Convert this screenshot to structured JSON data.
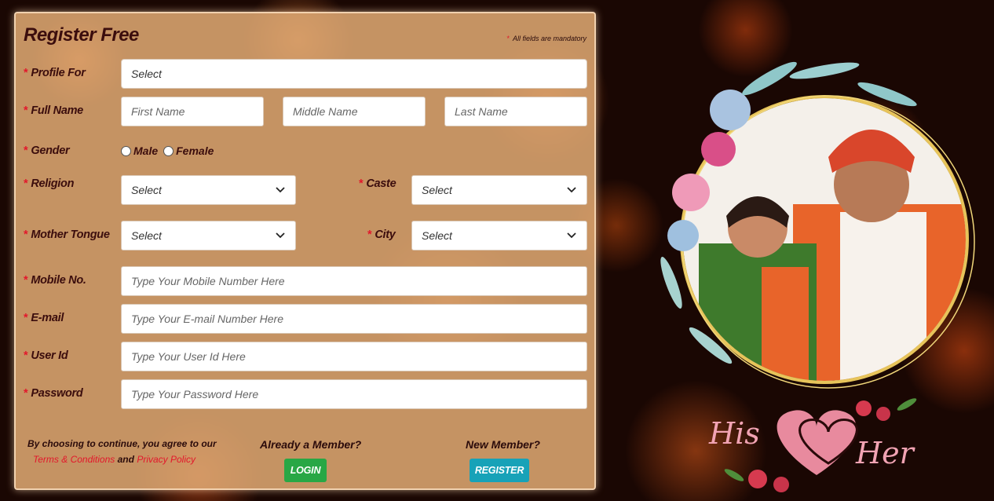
{
  "form": {
    "title": "Register Free",
    "mandatory_note": "All fields are mandatory",
    "required_mark": "*",
    "profile_for": {
      "label": "Profile For",
      "value": "Select"
    },
    "full_name": {
      "label": "Full Name",
      "first_placeholder": "First Name",
      "middle_placeholder": "Middle Name",
      "last_placeholder": "Last Name"
    },
    "gender": {
      "label": "Gender",
      "options": [
        "Male",
        "Female"
      ]
    },
    "religion": {
      "label": "Religion",
      "value": "Select"
    },
    "caste": {
      "label": "Caste",
      "value": "Select"
    },
    "mother_tongue": {
      "label": "Mother Tongue",
      "value": "Select"
    },
    "city": {
      "label": "City",
      "value": "Select"
    },
    "mobile": {
      "label": "Mobile No.",
      "placeholder": "Type Your Mobile Number Here"
    },
    "email": {
      "label": "E-mail",
      "placeholder": "Type Your E-mail Number Here"
    },
    "user_id": {
      "label": "User Id",
      "placeholder": "Type Your User Id Here"
    },
    "password": {
      "label": "Password",
      "placeholder": "Type Your Password Here"
    }
  },
  "footer": {
    "agree_text": "By choosing to continue, you agree to our",
    "terms_link": "Terms & Conditions",
    "and_text": "and",
    "privacy_link": "Privacy Policy",
    "member_question": "Already a Member?",
    "login_label": "LOGIN",
    "new_member_question": "New Member?",
    "register_label": "REGISTER"
  },
  "decor": {
    "his_text": "His",
    "her_text": "Her"
  },
  "colors": {
    "login_button": "#28a745",
    "register_button": "#17a2b8",
    "required_star": "#e3172b",
    "label_text": "#3b0d0d"
  }
}
